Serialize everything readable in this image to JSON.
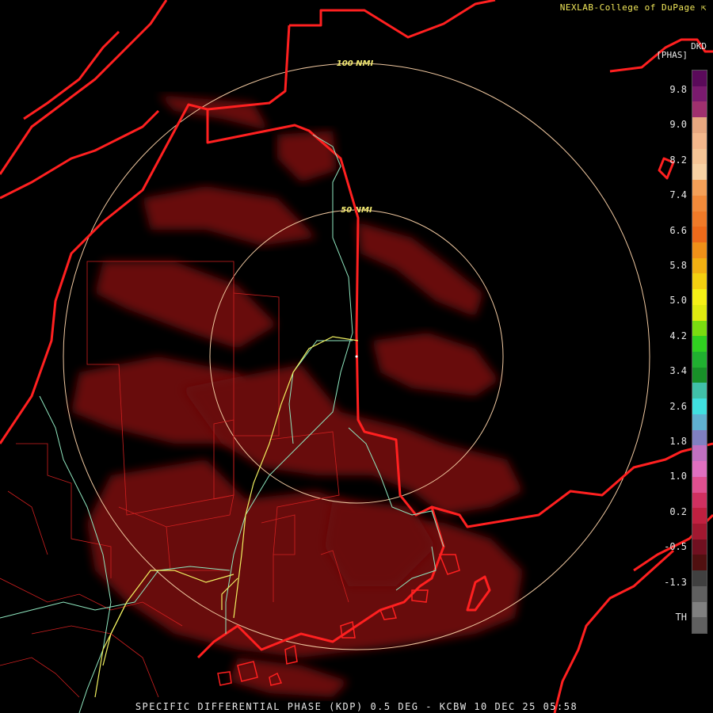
{
  "credit": "NEXLAB-College of DuPage",
  "credit_icon": "cursor-arrow-icon",
  "product_code": "DKD",
  "unit": "[PHAS]",
  "footer": "SPECIFIC DIFFERENTIAL PHASE (KDP) 0.5 DEG - KCBW 10 DEC 25 05:58",
  "range_rings": [
    {
      "label": "100 NMI"
    },
    {
      "label": "50 NMI"
    }
  ],
  "colorbar": {
    "ticks": [
      "9.8",
      "9.0",
      "8.2",
      "7.4",
      "6.6",
      "5.8",
      "5.0",
      "4.2",
      "3.4",
      "2.6",
      "1.8",
      "1.0",
      "0.2",
      "-0.5",
      "-1.3",
      "TH"
    ],
    "colors": [
      "#5a0a5a",
      "#7a1a6e",
      "#a0306e",
      "#e8a880",
      "#f4b88c",
      "#f6c596",
      "#f8d2a4",
      "#f4a058",
      "#f28a3a",
      "#f07a28",
      "#ee6a1a",
      "#f09018",
      "#f2b012",
      "#f4d010",
      "#f6f016",
      "#e0ea10",
      "#7adc10",
      "#30d020",
      "#20b030",
      "#189028",
      "#40c0a8",
      "#40e0e0",
      "#60b0d0",
      "#8080c0",
      "#c070c0",
      "#e070c0",
      "#e05090",
      "#d03060",
      "#c02040",
      "#a01830",
      "#701020",
      "#501010",
      "#404040",
      "#606060",
      "#808080",
      "#606060"
    ]
  },
  "colors": {
    "border": "#ff2020",
    "county": "#d02020",
    "ring": "#f0c8a0",
    "river": "#90e8c0",
    "road": "#f0f060",
    "echo": "#700a10"
  }
}
